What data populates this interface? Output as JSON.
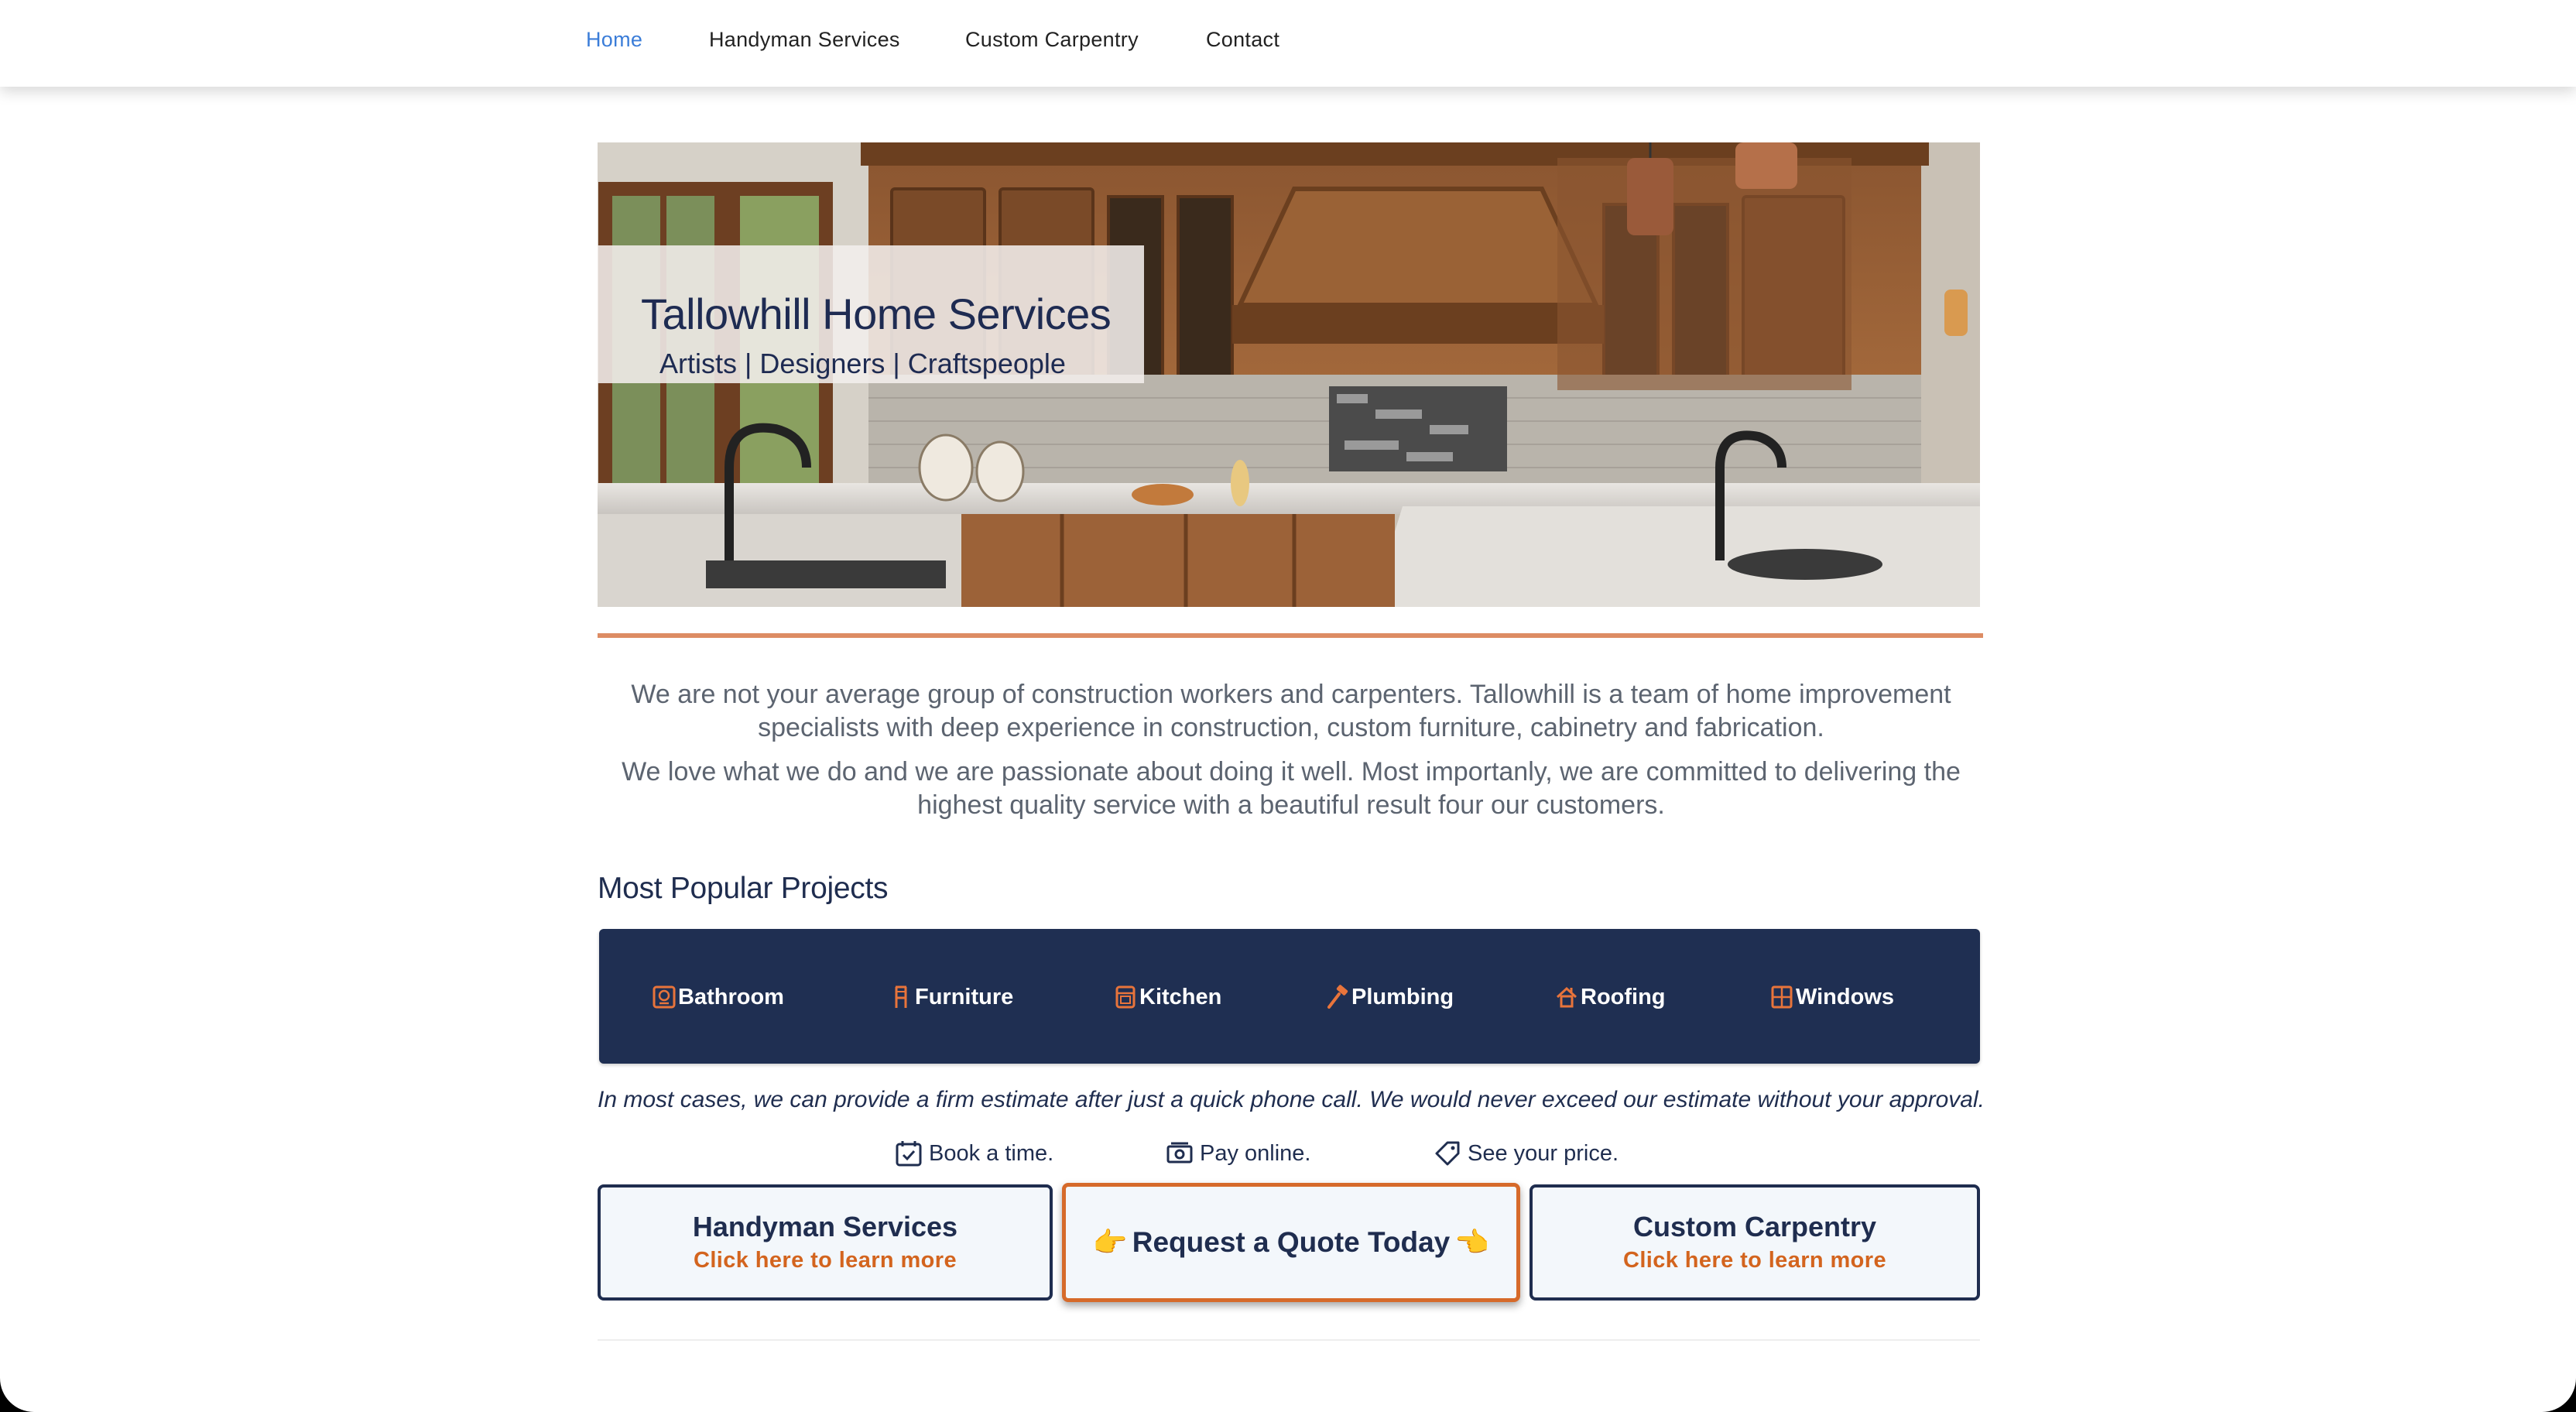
{
  "nav": {
    "items": [
      {
        "label": "Home",
        "active": true
      },
      {
        "label": "Handyman Services"
      },
      {
        "label": "Custom Carpentry"
      },
      {
        "label": "Contact"
      }
    ]
  },
  "hero": {
    "title": "Tallowhill Home Services",
    "subtitle": "Artists | Designers | Craftspeople"
  },
  "intro": {
    "paragraph1": "We are not your average group of construction workers and carpenters. Tallowhill is a team of home improvement specialists with deep experience in construction, custom furniture, cabinetry and fabrication.",
    "paragraph2": "We love what we do and we are passionate about doing it well. Most importanly, we are committed to delivering the highest quality service with a beautiful result four our customers."
  },
  "projects": {
    "title": "Most Popular Projects",
    "items": [
      {
        "label": "Bathroom",
        "icon": "bathroom-icon"
      },
      {
        "label": "Furniture",
        "icon": "chair-icon"
      },
      {
        "label": "Kitchen",
        "icon": "oven-icon"
      },
      {
        "label": "Plumbing",
        "icon": "hammer-icon"
      },
      {
        "label": "Roofing",
        "icon": "house-icon"
      },
      {
        "label": "Windows",
        "icon": "window-icon"
      }
    ]
  },
  "estimate_note": "In most cases, we can provide a firm estimate after just a quick phone call. We would never exceed our estimate without your approval.",
  "features": [
    {
      "label": "Book a time.",
      "icon": "calendar-check-icon"
    },
    {
      "label": "Pay online.",
      "icon": "cash-icon"
    },
    {
      "label": "See your price.",
      "icon": "tag-icon"
    }
  ],
  "cards": {
    "handyman": {
      "title": "Handyman Services",
      "link": "Click here to learn more"
    },
    "quote": {
      "label": "Request a Quote Today",
      "left_emoji": "👉",
      "right_emoji": "👈"
    },
    "carpentry": {
      "title": "Custom Carpentry",
      "link": "Click here to learn more"
    }
  },
  "colors": {
    "navy": "#1f2d4f",
    "accent_orange": "#d3641e",
    "active_link": "#3b7dd8",
    "rule": "#dd8c64"
  }
}
